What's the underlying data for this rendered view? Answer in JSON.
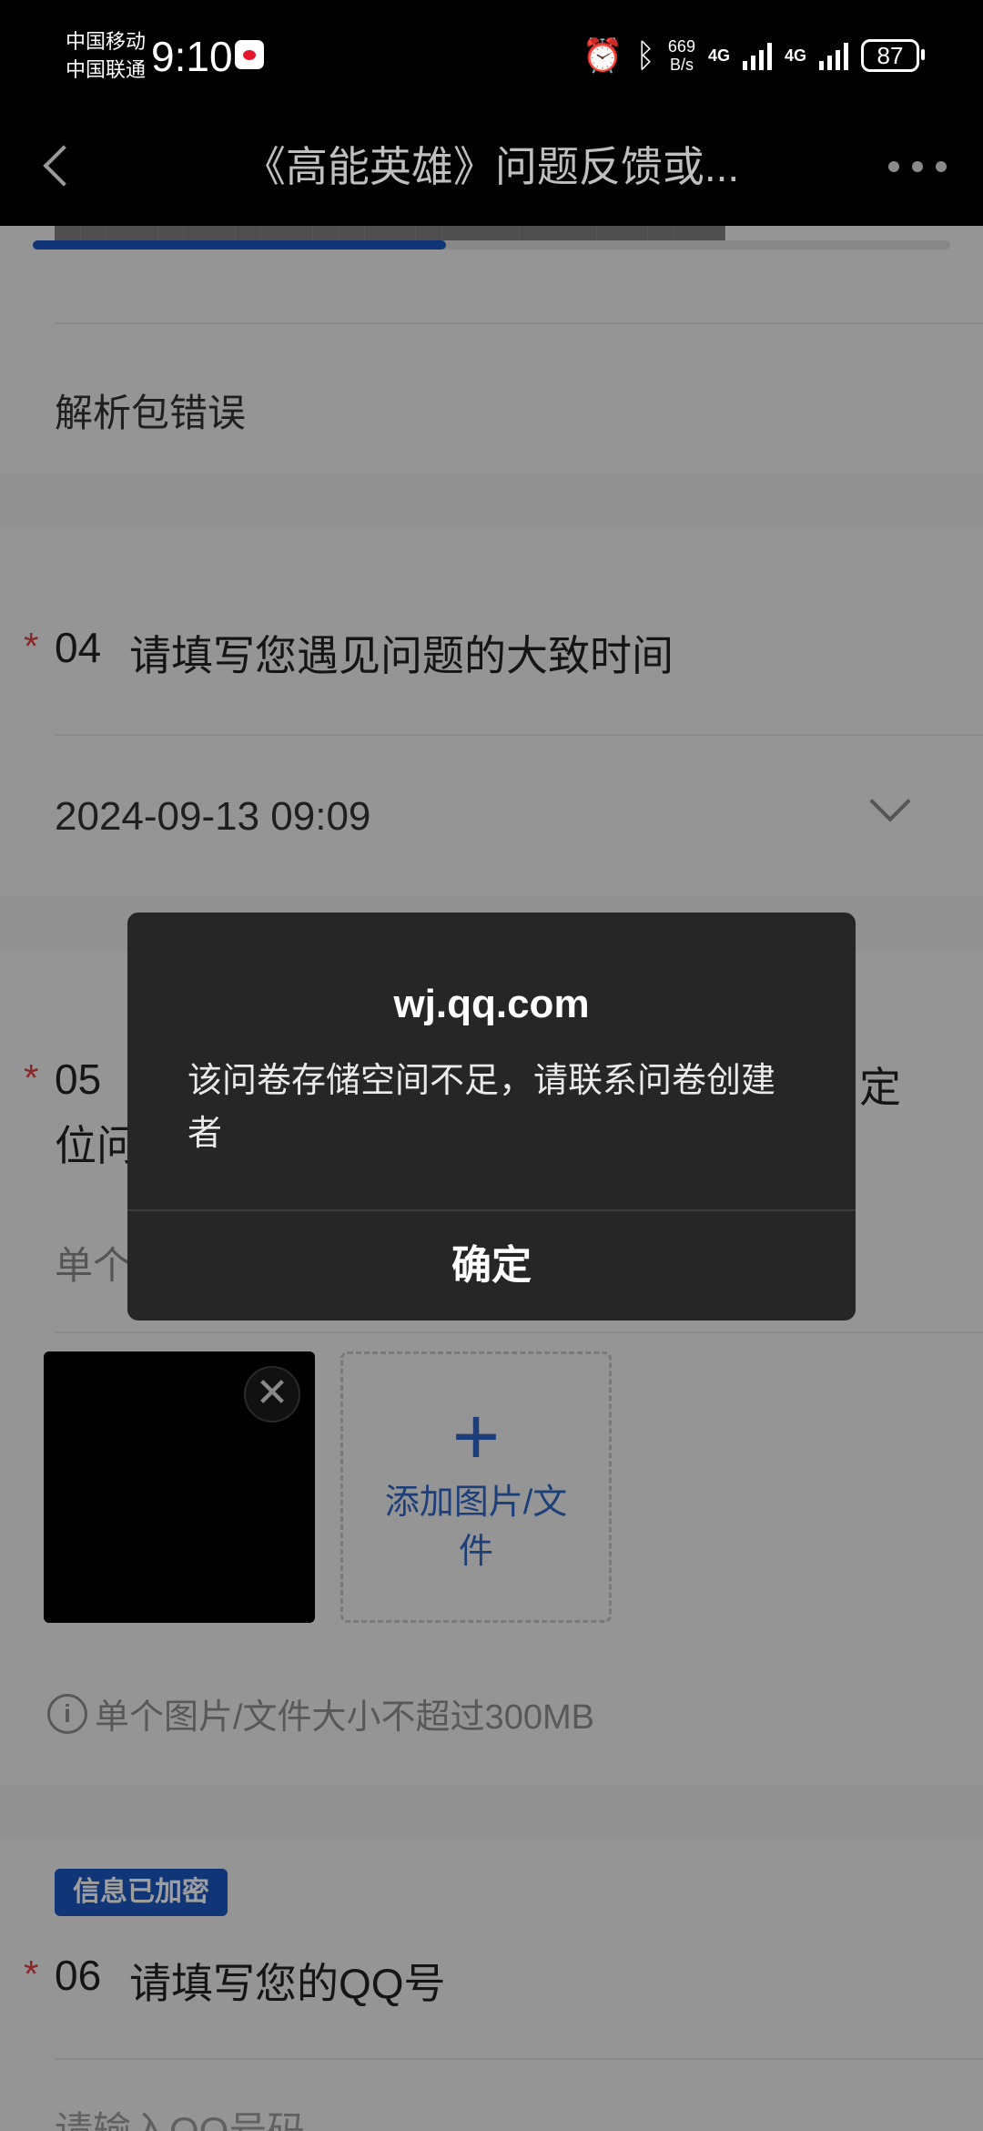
{
  "status_bar": {
    "carrier1": "中国移动",
    "carrier2": "中国联通",
    "time": "9:10",
    "net_speed_value": "669",
    "net_speed_unit": "B/s",
    "net1": "4G",
    "net2": "4G",
    "battery": "87"
  },
  "nav": {
    "title": "《高能英雄》问题反馈或..."
  },
  "form": {
    "progress_fraction": 0.45,
    "q3": {
      "selected_option": "解析包错误"
    },
    "q4": {
      "required_mark": "*",
      "number": "04",
      "title": "请填写您遇见问题的大致时间",
      "value": "2024-09-13 09:09"
    },
    "q5": {
      "required_mark": "*",
      "number": "05",
      "title_tail": "定",
      "title_line2_head": "位问",
      "subtitle_head": "单个",
      "add_label": "添加图片/文件",
      "hint": "单个图片/文件大小不超过300MB"
    },
    "q6": {
      "badge": "信息已加密",
      "required_mark": "*",
      "number": "06",
      "title": "请填写您的QQ号",
      "placeholder": "请输入QQ号码"
    }
  },
  "dialog": {
    "title": "wj.qq.com",
    "message": "该问卷存储空间不足，请联系问卷创建者",
    "confirm": "确定"
  }
}
